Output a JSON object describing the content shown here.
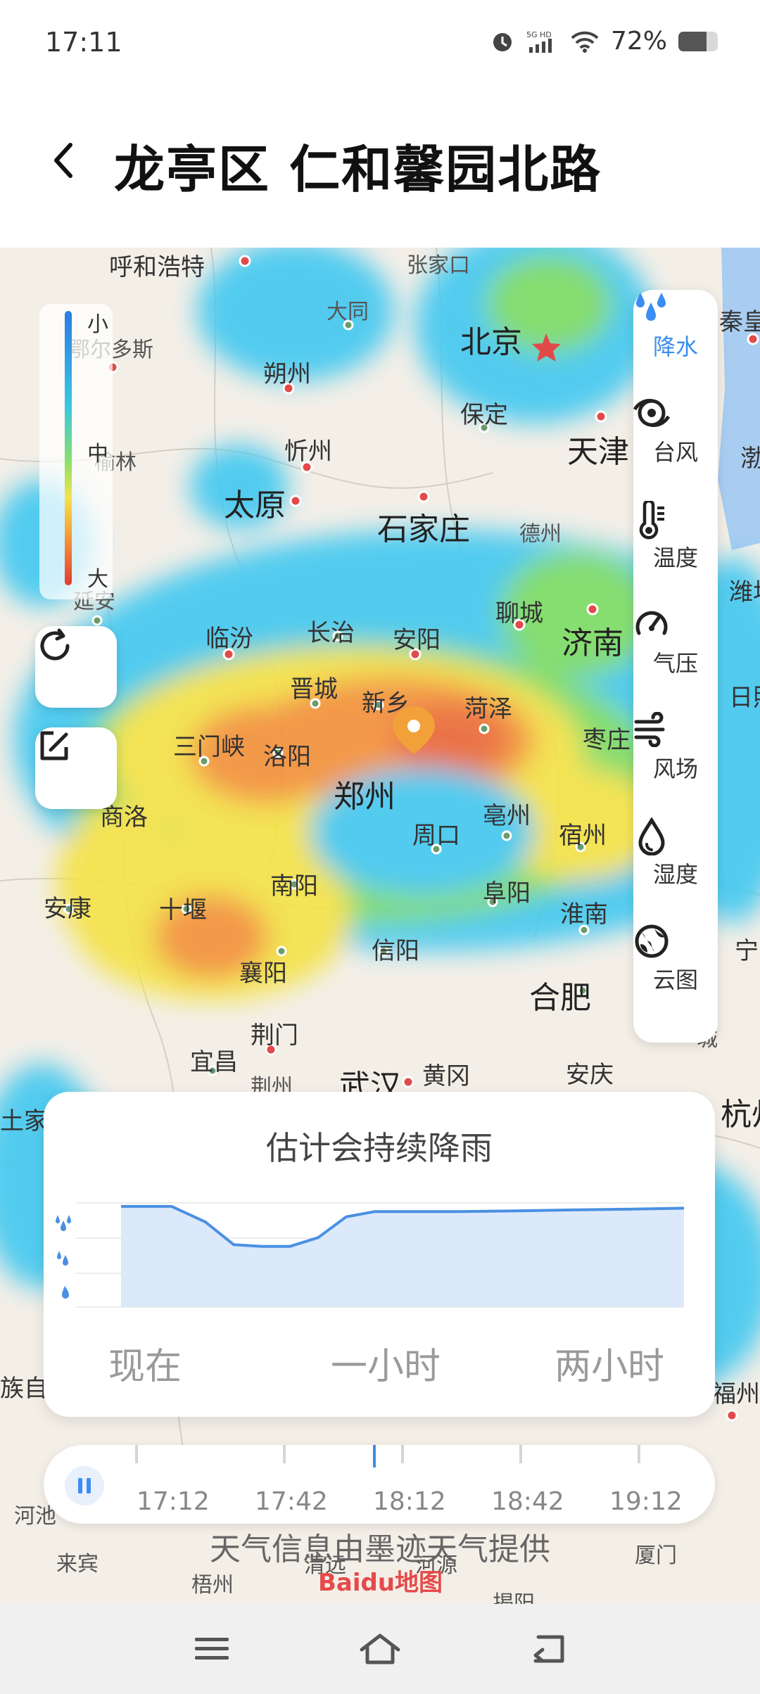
{
  "status_bar": {
    "time": "17:11",
    "network": "5G HD",
    "battery_percent_text": "72%",
    "battery_level": 0.72,
    "icons": [
      "alarm-icon",
      "signal-icon",
      "wifi-icon",
      "battery-icon"
    ]
  },
  "header": {
    "back_icon": "chevron-left-icon",
    "title": "龙亭区 仁和馨园北路"
  },
  "map": {
    "legend": {
      "top": "小",
      "middle": "中",
      "bottom": "大"
    },
    "cities": [
      "呼和浩特",
      "鄂尔多斯",
      "榆林",
      "延安",
      "大同",
      "朔州",
      "忻州",
      "太原",
      "石家庄",
      "北京",
      "天津",
      "保定",
      "德州",
      "临汾",
      "长治",
      "安阳",
      "聊城",
      "济南",
      "晋城",
      "新乡",
      "菏泽",
      "三门峡",
      "洛阳",
      "郑州",
      "枣庄",
      "商洛",
      "周口",
      "亳州",
      "宿州",
      "安康",
      "十堰",
      "南阳",
      "阜阳",
      "淮南",
      "襄阳",
      "信阳",
      "合肥",
      "荆门",
      "宜昌",
      "荆州",
      "武汉",
      "黄冈",
      "安庆",
      "杭州",
      "秦皇",
      "渤",
      "潍坊",
      "日照",
      "宁",
      "土家",
      "族自",
      "福州",
      "河池",
      "来宾",
      "梧州",
      "清远",
      "河源",
      "揭阳",
      "厦门",
      "张家口",
      "城"
    ],
    "buttons": {
      "refresh_icon": "refresh-icon",
      "edit_icon": "edit-icon"
    },
    "layers": [
      {
        "label": "降水",
        "icon": "rain-drops-icon",
        "active": true
      },
      {
        "label": "台风",
        "icon": "typhoon-icon",
        "active": false
      },
      {
        "label": "温度",
        "icon": "thermometer-icon",
        "active": false
      },
      {
        "label": "气压",
        "icon": "gauge-icon",
        "active": false
      },
      {
        "label": "风场",
        "icon": "wind-icon",
        "active": false
      },
      {
        "label": "湿度",
        "icon": "droplet-icon",
        "active": false
      },
      {
        "label": "云图",
        "icon": "globe-icon",
        "active": false
      }
    ]
  },
  "forecast": {
    "title": "估计会持续降雨",
    "x_labels": [
      "现在",
      "一小时",
      "两小时"
    ],
    "intensity_icons": [
      "heavy-rain-icon",
      "moderate-rain-icon",
      "light-rain-icon"
    ],
    "chart_data": {
      "type": "area",
      "x_labels": [
        "现在",
        "一小时",
        "两小时"
      ],
      "y_levels": [
        "light",
        "moderate",
        "heavy"
      ],
      "ylim": [
        0,
        3
      ],
      "x": [
        0,
        0.09,
        0.15,
        0.2,
        0.25,
        0.3,
        0.35,
        0.4,
        0.45,
        0.5,
        0.6,
        0.7,
        0.8,
        0.9,
        1.0
      ],
      "values": [
        2.9,
        2.9,
        2.45,
        1.8,
        1.75,
        1.75,
        2.0,
        2.6,
        2.75,
        2.75,
        2.75,
        2.77,
        2.8,
        2.82,
        2.85
      ]
    }
  },
  "timeline": {
    "play_icon": "pause-icon",
    "labels": [
      "17:12",
      "17:42",
      "18:12",
      "18:42",
      "19:12"
    ],
    "current_index": 2
  },
  "credit": {
    "text": "天气信息由墨迹天气提供",
    "logo_text": "Baidu地图"
  },
  "navbar": {
    "icons": [
      "menu-icon",
      "home-icon",
      "back-icon"
    ]
  }
}
